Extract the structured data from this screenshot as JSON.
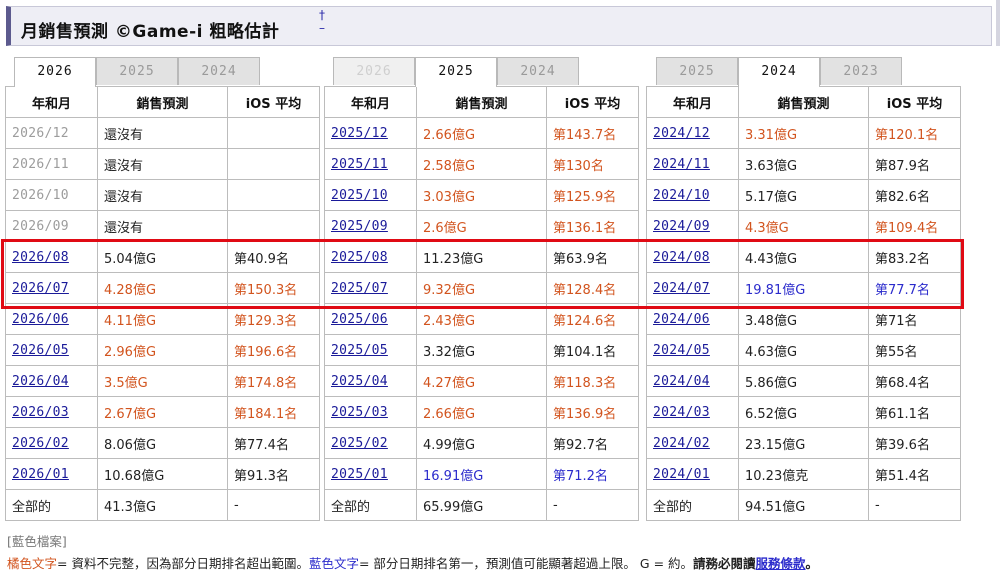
{
  "header": {
    "title": "月銷售預測 ©Game-i 粗略估計",
    "toggle_top": "†",
    "toggle_bottom": "–"
  },
  "columns": {
    "date": "年和月",
    "sales": "銷售預測",
    "ios": "iOS 平均"
  },
  "panels": [
    {
      "tabs": [
        {
          "label": "2026",
          "state": "active"
        },
        {
          "label": "2025",
          "state": "inactive"
        },
        {
          "label": "2024",
          "state": "inactive"
        }
      ],
      "rows": [
        {
          "date": "2026/12",
          "sales": "還沒有",
          "ios": "",
          "date_style": "grey",
          "sales_style": "",
          "ios_style": ""
        },
        {
          "date": "2026/11",
          "sales": "還沒有",
          "ios": "",
          "date_style": "grey",
          "sales_style": "",
          "ios_style": ""
        },
        {
          "date": "2026/10",
          "sales": "還沒有",
          "ios": "",
          "date_style": "grey",
          "sales_style": "",
          "ios_style": ""
        },
        {
          "date": "2026/09",
          "sales": "還沒有",
          "ios": "",
          "date_style": "grey",
          "sales_style": "",
          "ios_style": ""
        },
        {
          "date": "2026/08",
          "sales": "5.04億G",
          "ios": "第40.9名",
          "date_style": "link",
          "sales_style": "",
          "ios_style": ""
        },
        {
          "date": "2026/07",
          "sales": "4.28億G",
          "ios": "第150.3名",
          "date_style": "link",
          "sales_style": "orange",
          "ios_style": "orange"
        },
        {
          "date": "2026/06",
          "sales": "4.11億G",
          "ios": "第129.3名",
          "date_style": "link",
          "sales_style": "orange",
          "ios_style": "orange"
        },
        {
          "date": "2026/05",
          "sales": "2.96億G",
          "ios": "第196.6名",
          "date_style": "link",
          "sales_style": "orange",
          "ios_style": "orange"
        },
        {
          "date": "2026/04",
          "sales": "3.5億G",
          "ios": "第174.8名",
          "date_style": "link",
          "sales_style": "orange",
          "ios_style": "orange"
        },
        {
          "date": "2026/03",
          "sales": "2.67億G",
          "ios": "第184.1名",
          "date_style": "link",
          "sales_style": "orange",
          "ios_style": "orange"
        },
        {
          "date": "2026/02",
          "sales": "8.06億G",
          "ios": "第77.4名",
          "date_style": "link",
          "sales_style": "",
          "ios_style": ""
        },
        {
          "date": "2026/01",
          "sales": "10.68億G",
          "ios": "第91.3名",
          "date_style": "link",
          "sales_style": "",
          "ios_style": ""
        },
        {
          "date": "全部的",
          "sales": "41.3億G",
          "ios": "-",
          "date_style": "",
          "sales_style": "",
          "ios_style": ""
        }
      ]
    },
    {
      "tabs": [
        {
          "label": "2026",
          "state": "faded"
        },
        {
          "label": "2025",
          "state": "active"
        },
        {
          "label": "2024",
          "state": "inactive"
        }
      ],
      "rows": [
        {
          "date": "2025/12",
          "sales": "2.66億G",
          "ios": "第143.7名",
          "date_style": "link",
          "sales_style": "orange",
          "ios_style": "orange"
        },
        {
          "date": "2025/11",
          "sales": "2.58億G",
          "ios": "第130名",
          "date_style": "link",
          "sales_style": "orange",
          "ios_style": "orange"
        },
        {
          "date": "2025/10",
          "sales": "3.03億G",
          "ios": "第125.9名",
          "date_style": "link",
          "sales_style": "orange",
          "ios_style": "orange"
        },
        {
          "date": "2025/09",
          "sales": "2.6億G",
          "ios": "第136.1名",
          "date_style": "link",
          "sales_style": "orange",
          "ios_style": "orange"
        },
        {
          "date": "2025/08",
          "sales": "11.23億G",
          "ios": "第63.9名",
          "date_style": "link",
          "sales_style": "",
          "ios_style": ""
        },
        {
          "date": "2025/07",
          "sales": "9.32億G",
          "ios": "第128.4名",
          "date_style": "link",
          "sales_style": "orange",
          "ios_style": "orange"
        },
        {
          "date": "2025/06",
          "sales": "2.43億G",
          "ios": "第124.6名",
          "date_style": "link",
          "sales_style": "orange",
          "ios_style": "orange"
        },
        {
          "date": "2025/05",
          "sales": "3.32億G",
          "ios": "第104.1名",
          "date_style": "link",
          "sales_style": "",
          "ios_style": ""
        },
        {
          "date": "2025/04",
          "sales": "4.27億G",
          "ios": "第118.3名",
          "date_style": "link",
          "sales_style": "orange",
          "ios_style": "orange"
        },
        {
          "date": "2025/03",
          "sales": "2.66億G",
          "ios": "第136.9名",
          "date_style": "link",
          "sales_style": "orange",
          "ios_style": "orange"
        },
        {
          "date": "2025/02",
          "sales": "4.99億G",
          "ios": "第92.7名",
          "date_style": "link",
          "sales_style": "",
          "ios_style": ""
        },
        {
          "date": "2025/01",
          "sales": "16.91億G",
          "ios": "第71.2名",
          "date_style": "link",
          "sales_style": "blue",
          "ios_style": "blue"
        },
        {
          "date": "全部的",
          "sales": "65.99億G",
          "ios": "-",
          "date_style": "",
          "sales_style": "",
          "ios_style": ""
        }
      ]
    },
    {
      "tabs": [
        {
          "label": "2025",
          "state": "inactive"
        },
        {
          "label": "2024",
          "state": "active"
        },
        {
          "label": "2023",
          "state": "inactive"
        }
      ],
      "rows": [
        {
          "date": "2024/12",
          "sales": "3.31億G",
          "ios": "第120.1名",
          "date_style": "link",
          "sales_style": "orange",
          "ios_style": "orange"
        },
        {
          "date": "2024/11",
          "sales": "3.63億G",
          "ios": "第87.9名",
          "date_style": "link",
          "sales_style": "",
          "ios_style": ""
        },
        {
          "date": "2024/10",
          "sales": "5.17億G",
          "ios": "第82.6名",
          "date_style": "link",
          "sales_style": "",
          "ios_style": ""
        },
        {
          "date": "2024/09",
          "sales": "4.3億G",
          "ios": "第109.4名",
          "date_style": "link",
          "sales_style": "orange",
          "ios_style": "orange"
        },
        {
          "date": "2024/08",
          "sales": "4.43億G",
          "ios": "第83.2名",
          "date_style": "link",
          "sales_style": "",
          "ios_style": ""
        },
        {
          "date": "2024/07",
          "sales": "19.81億G",
          "ios": "第77.7名",
          "date_style": "link",
          "sales_style": "blue",
          "ios_style": "blue"
        },
        {
          "date": "2024/06",
          "sales": "3.48億G",
          "ios": "第71名",
          "date_style": "link",
          "sales_style": "",
          "ios_style": ""
        },
        {
          "date": "2024/05",
          "sales": "4.63億G",
          "ios": "第55名",
          "date_style": "link",
          "sales_style": "",
          "ios_style": ""
        },
        {
          "date": "2024/04",
          "sales": "5.86億G",
          "ios": "第68.4名",
          "date_style": "link",
          "sales_style": "",
          "ios_style": ""
        },
        {
          "date": "2024/03",
          "sales": "6.52億G",
          "ios": "第61.1名",
          "date_style": "link",
          "sales_style": "",
          "ios_style": ""
        },
        {
          "date": "2024/02",
          "sales": "23.15億G",
          "ios": "第39.6名",
          "date_style": "link",
          "sales_style": "",
          "ios_style": ""
        },
        {
          "date": "2024/01",
          "sales": "10.23億克",
          "ios": "第51.4名",
          "date_style": "link",
          "sales_style": "",
          "ios_style": ""
        },
        {
          "date": "全部的",
          "sales": "94.51億G",
          "ios": "-",
          "date_style": "",
          "sales_style": "",
          "ios_style": ""
        }
      ]
    }
  ],
  "legend": {
    "title": "[藍色檔案]",
    "orange_label": "橘色文字",
    "orange_text": "= 資料不完整，因為部分日期排名超出範圍。",
    "blue_label": "藍色文字",
    "blue_text": "= 部分日期排名第一，預測值可能顯著超過上限。 G = 約。",
    "must_read": "請務必閱讀",
    "terms_link": "服務條款",
    "terms_tail": "。"
  },
  "colors": {
    "orange": "#d2541e",
    "blue": "#2b2bcc",
    "link": "#1a1a99",
    "highlight": "#e00a14",
    "header_accent": "#5c5a8e"
  }
}
